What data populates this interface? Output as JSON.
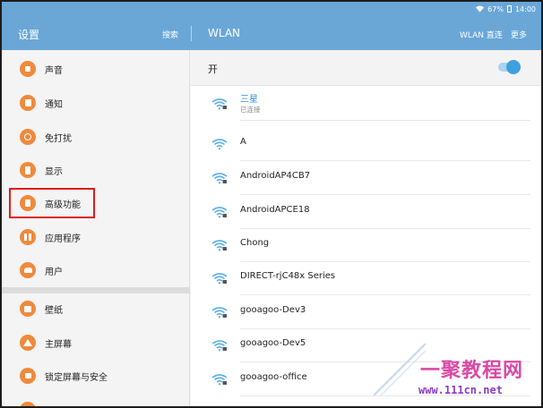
{
  "status_bar": {
    "battery": "67%",
    "time": "14:00"
  },
  "header": {
    "left_title": "设置",
    "search_label": "搜索",
    "right_title": "WLAN",
    "wlan_direct_label": "WLAN 直连",
    "more_label": "更多"
  },
  "sidebar": {
    "accent_color": "#ef8a3c",
    "highlighted_item": "高级功能",
    "items": [
      {
        "label": "声音",
        "icon": "speaker-icon"
      },
      {
        "label": "通知",
        "icon": "notification-icon"
      },
      {
        "label": "免打扰",
        "icon": "do-not-disturb-icon"
      },
      {
        "label": "显示",
        "icon": "display-icon"
      },
      {
        "label": "高级功能",
        "icon": "advanced-features-icon"
      },
      {
        "label": "应用程序",
        "icon": "apps-grid-icon"
      },
      {
        "label": "用户",
        "icon": "users-icon"
      },
      {
        "label": "壁纸",
        "icon": "wallpaper-icon"
      },
      {
        "label": "主屏幕",
        "icon": "home-icon"
      },
      {
        "label": "锁定屏幕与安全",
        "icon": "lock-icon"
      }
    ]
  },
  "wlan": {
    "toggle_label": "开",
    "toggle_on": true,
    "accent_color": "#3ea1de",
    "networks": [
      {
        "name": "三星",
        "status": "已连接",
        "secured": true
      },
      {
        "name": "A",
        "secured": false
      },
      {
        "name": "AndroidAP4CB7",
        "secured": true
      },
      {
        "name": "AndroidAPCE18",
        "secured": true
      },
      {
        "name": "Chong",
        "secured": true
      },
      {
        "name": "DIRECT-rjC48x Series",
        "secured": true
      },
      {
        "name": "gooagoo-Dev3",
        "secured": true
      },
      {
        "name": "gooagoo-Dev5",
        "secured": true
      },
      {
        "name": "gooagoo-office",
        "secured": true
      }
    ]
  },
  "watermark": {
    "main_text": "一聚教程网",
    "sub_text": "www.111cn.net"
  }
}
